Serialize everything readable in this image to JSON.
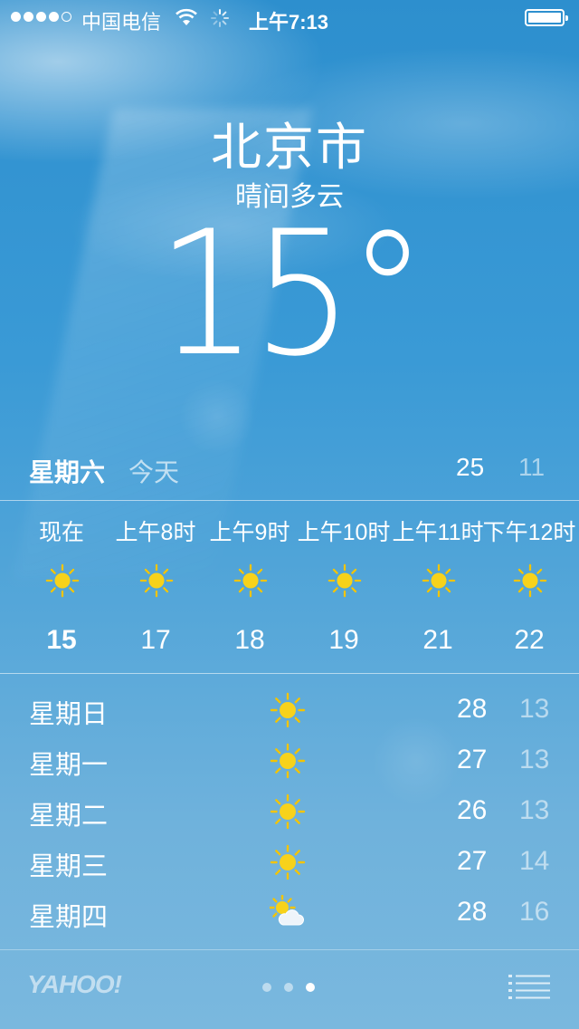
{
  "status_bar": {
    "carrier": "中国电信",
    "time": "上午7:13"
  },
  "location": {
    "city": "北京市",
    "condition": "晴间多云",
    "temperature": "15°"
  },
  "today": {
    "day": "星期六",
    "label": "今天",
    "high": "25",
    "low": "11"
  },
  "hourly": [
    {
      "time": "现在",
      "icon": "sun-icon",
      "temp": "15"
    },
    {
      "time": "上午8时",
      "icon": "sun-icon",
      "temp": "17"
    },
    {
      "time": "上午9时",
      "icon": "sun-icon",
      "temp": "18"
    },
    {
      "time": "上午10时",
      "icon": "sun-icon",
      "temp": "19"
    },
    {
      "time": "上午11时",
      "icon": "sun-icon",
      "temp": "21"
    },
    {
      "time": "下午12时",
      "icon": "sun-icon",
      "temp": "22"
    }
  ],
  "daily": [
    {
      "day": "星期日",
      "icon": "sun-icon",
      "high": "28",
      "low": "13"
    },
    {
      "day": "星期一",
      "icon": "sun-icon",
      "high": "27",
      "low": "13"
    },
    {
      "day": "星期二",
      "icon": "sun-icon",
      "high": "26",
      "low": "13"
    },
    {
      "day": "星期三",
      "icon": "sun-icon",
      "high": "27",
      "low": "14"
    },
    {
      "day": "星期四",
      "icon": "partly-cloudy-icon",
      "high": "28",
      "low": "16"
    }
  ],
  "footer": {
    "provider": "YAHOO!",
    "page_count": 3,
    "active_page": 3
  },
  "colors": {
    "sun": "#f7d21b",
    "sun_ray": "#f3c400",
    "sky_top": "#2d8fce",
    "sky_bottom": "#7ab8de"
  }
}
